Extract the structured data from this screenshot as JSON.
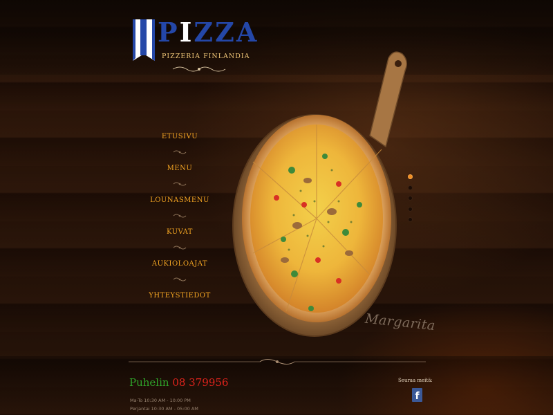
{
  "logo": {
    "word_prefix": "P",
    "word_white": "I",
    "word_rest": "ZZA",
    "subtitle": "PIZZERIA FINLANDIA"
  },
  "nav": {
    "items": [
      {
        "label": "ETUSIVU"
      },
      {
        "label": "MENU"
      },
      {
        "label": "LOUNASMENU"
      },
      {
        "label": "KUVAT"
      },
      {
        "label": "AUKIOLOAJAT"
      },
      {
        "label": "YHTEYSTIEDOT"
      }
    ]
  },
  "slider": {
    "caption": "Margarita",
    "dot_count": 5,
    "active_index": 0
  },
  "footer": {
    "phone_label": "Puhelin",
    "phone_number": "08 379956",
    "hours": [
      "Ma-To 10:30 AM - 10:00 PM",
      "Perjantai 10:30 AM - 05:00 AM"
    ],
    "follow_label": "Seuraa meitä:",
    "facebook_glyph": "f"
  },
  "colors": {
    "nav_text": "#f5a623",
    "logo_blue": "#2447a8",
    "phone_label": "#2fa42a",
    "phone_number": "#e0231c",
    "active_dot": "#f28c1e",
    "facebook": "#3b5998"
  }
}
